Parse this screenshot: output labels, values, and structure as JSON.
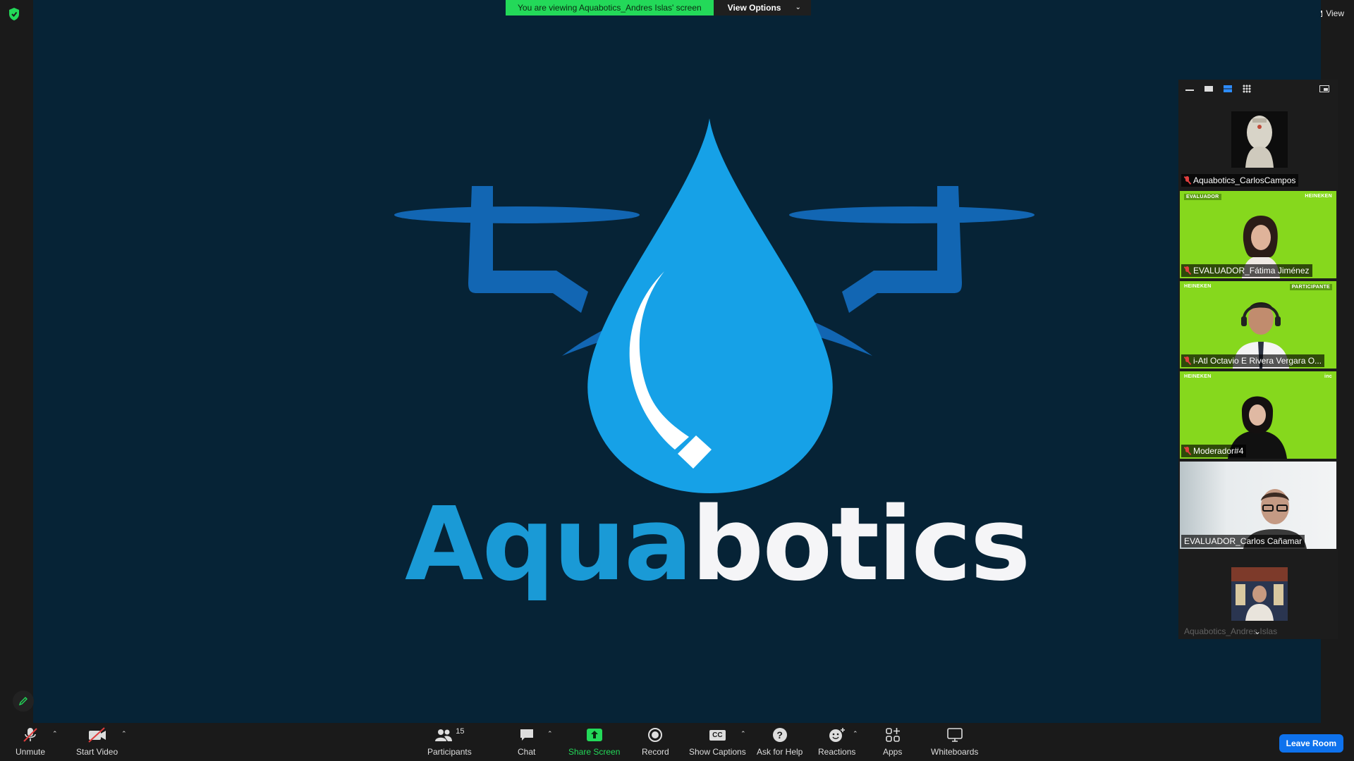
{
  "banner": {
    "message": "You are viewing Aquabotics_Andres Islas' screen",
    "view_options": "View Options",
    "view_options_caret": "⌄"
  },
  "top_right": {
    "view_label": "View"
  },
  "logo": {
    "part1": "Aqua",
    "part2": "botics"
  },
  "colors": {
    "share_bg": "#062336",
    "logo_blue": "#1a9ad6",
    "drone_arm": "#1266b3",
    "banner_green": "#23d959",
    "leave_blue": "#0e72ed",
    "tile_green": "#86d81d"
  },
  "gallery": {
    "participants": [
      {
        "name": "Aquabotics_CarlosCampos",
        "muted": true,
        "style": "avatar"
      },
      {
        "name": "EVALUADOR_Fátima Jiménez",
        "muted": true,
        "style": "green",
        "brand_left": "EVALUADOR",
        "brand_right": "HEINEKEN"
      },
      {
        "name": "i-Atl Octavio E Rivera Vergara O...",
        "muted": true,
        "style": "green",
        "brand_left": "HEINEKEN",
        "brand_right": "PARTICIPANTE"
      },
      {
        "name": "Moderador#4",
        "muted": true,
        "style": "green",
        "brand_left": "HEINEKEN",
        "brand_right": "inc"
      },
      {
        "name": "EVALUADOR_Carlos Cañamar",
        "muted": false,
        "style": "office"
      },
      {
        "name": "Aquabotics_Andres Islas",
        "muted": true,
        "style": "avatar-small"
      }
    ]
  },
  "toolbar": {
    "unmute": "Unmute",
    "start_video": "Start Video",
    "participants": "Participants",
    "participants_count": "15",
    "chat": "Chat",
    "share_screen": "Share Screen",
    "record": "Record",
    "show_captions": "Show Captions",
    "ask_for_help": "Ask for Help",
    "reactions": "Reactions",
    "apps": "Apps",
    "whiteboards": "Whiteboards",
    "leave_room": "Leave Room",
    "caret": "⌃",
    "cc": "CC",
    "help": "?"
  },
  "icons": [
    "shield-icon",
    "grid-icon",
    "mic-muted-icon",
    "video-off-icon",
    "participants-icon",
    "chat-icon",
    "share-screen-icon",
    "record-icon",
    "captions-icon",
    "help-icon",
    "reactions-icon",
    "apps-icon",
    "whiteboard-icon",
    "pencil-icon",
    "chevron-down-icon"
  ]
}
